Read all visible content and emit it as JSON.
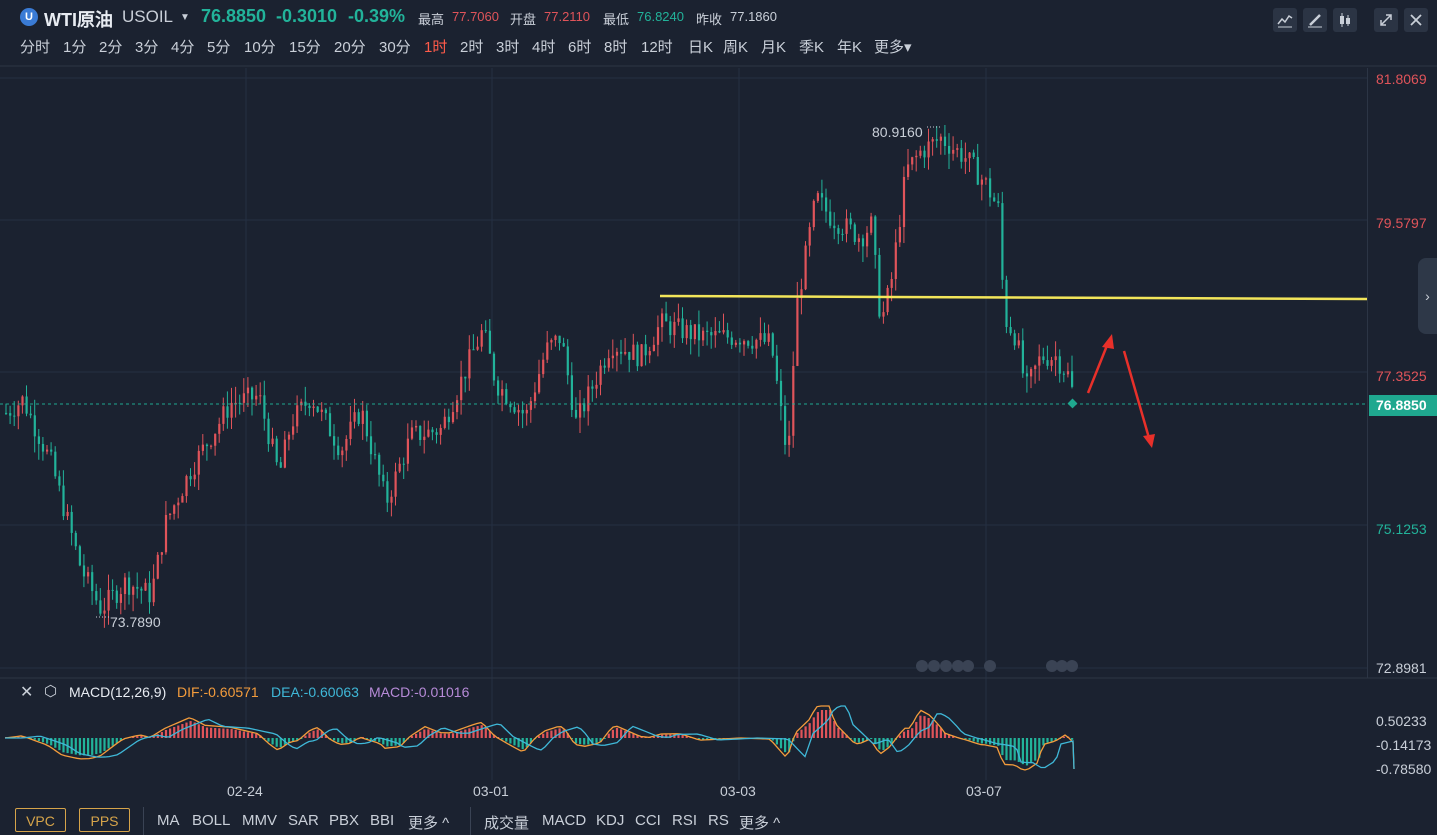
{
  "header": {
    "symbol_icon": "U",
    "name": "WTI原油",
    "code": "USOIL",
    "price": "76.8850",
    "change": "-0.3010",
    "change_pct": "-0.39%",
    "high_label": "最高",
    "high": "77.7060",
    "open_label": "开盘",
    "open": "77.2110",
    "low_label": "最低",
    "low": "76.8240",
    "prev_label": "昨收",
    "prev": "77.1860"
  },
  "toolbar_icons": [
    "line-chart-icon",
    "draw-pen-icon",
    "candlestick-icon",
    "expand-icon",
    "close-icon"
  ],
  "timeframes": [
    "分时",
    "1分",
    "2分",
    "3分",
    "4分",
    "5分",
    "10分",
    "15分",
    "20分",
    "30分",
    "1时",
    "2时",
    "3时",
    "4时",
    "6时",
    "8时",
    "12时",
    "日K",
    "周K",
    "月K",
    "季K",
    "年K",
    "更多▾"
  ],
  "active_timeframe": "1时",
  "price_axis": {
    "ticks": [
      {
        "label": "81.8069",
        "color": "#e0545a"
      },
      {
        "label": "79.5797",
        "color": "#e0545a"
      },
      {
        "label": "77.3525",
        "color": "#e0545a"
      },
      {
        "label": "75.1253",
        "color": "#22b39a"
      },
      {
        "label": "72.8981",
        "color": "#c9cfd8"
      }
    ],
    "current_price": "76.8850"
  },
  "annotations": {
    "high_marker": "80.9160",
    "low_marker": "73.7890"
  },
  "macd": {
    "title": "MACD(12,26,9)",
    "dif": "DIF:-0.60571",
    "dea": "DEA:-0.60063",
    "macd": "MACD:-0.01016",
    "ticks": [
      "0.50233",
      "-0.14173",
      "-0.78580"
    ]
  },
  "x_axis": [
    "02-24",
    "03-01",
    "03-03",
    "03-07"
  ],
  "bottom": {
    "boxes": [
      "VPC",
      "PPS"
    ],
    "main_indicators": [
      "MA",
      "BOLL",
      "MMV",
      "SAR",
      "PBX",
      "BBI",
      "更多 ^"
    ],
    "sub_indicators": [
      "成交量",
      "MACD",
      "KDJ",
      "CCI",
      "RSI",
      "RS",
      "更多 ^"
    ]
  },
  "colors": {
    "up": "#e0545a",
    "down": "#22b39a",
    "bg": "#1b2230",
    "trendline": "#f3e65a",
    "arrow": "#e8302a"
  },
  "chart_data": {
    "type": "candlestick",
    "x_ticks": [
      "02-24",
      "03-01",
      "03-03",
      "03-07"
    ],
    "ylim": [
      72.8981,
      81.8069
    ],
    "last_price": 76.885,
    "annotated_high": 80.916,
    "annotated_low": 73.789,
    "horizontal_line_level": 78.15
  }
}
